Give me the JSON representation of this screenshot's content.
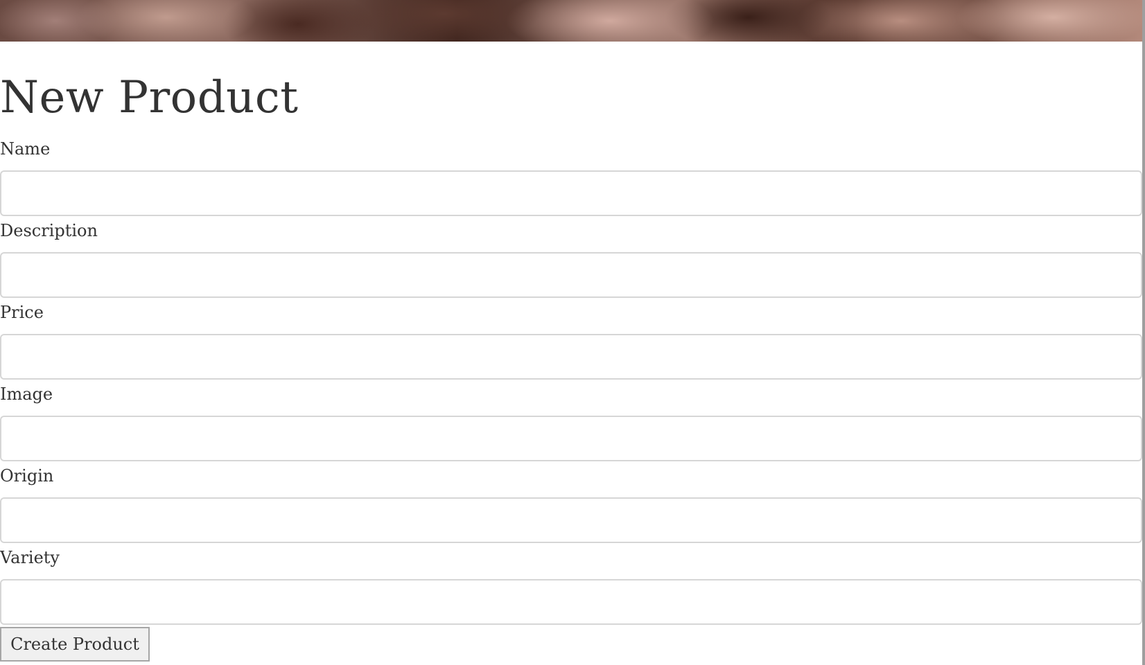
{
  "page": {
    "title": "New Product"
  },
  "form": {
    "fields": [
      {
        "key": "name",
        "label": "Name",
        "value": ""
      },
      {
        "key": "description",
        "label": "Description",
        "value": ""
      },
      {
        "key": "price",
        "label": "Price",
        "value": ""
      },
      {
        "key": "image",
        "label": "Image",
        "value": ""
      },
      {
        "key": "origin",
        "label": "Origin",
        "value": ""
      },
      {
        "key": "variety",
        "label": "Variety",
        "value": ""
      }
    ],
    "submit_label": "Create Product"
  },
  "colors": {
    "text": "#333333",
    "input_border": "#d6d6d6",
    "button_background": "#f0f0f0",
    "button_border": "#a6a6a6"
  }
}
